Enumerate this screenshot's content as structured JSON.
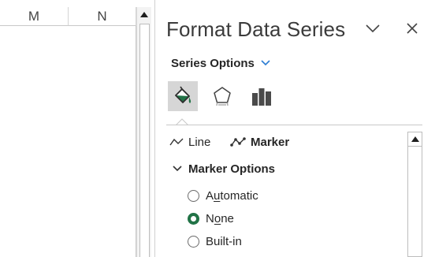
{
  "sheet": {
    "columns": [
      "M",
      "N"
    ]
  },
  "pane": {
    "title": "Format Data Series",
    "series_options_label": "Series Options",
    "tabs": [
      {
        "name": "fill-line",
        "icon": "paint-bucket-icon",
        "selected": true
      },
      {
        "name": "effects",
        "icon": "pentagon-icon",
        "selected": false
      },
      {
        "name": "series-options",
        "icon": "bar-chart-icon",
        "selected": false
      }
    ],
    "subtabs": {
      "line": "Line",
      "marker": "Marker"
    },
    "section": {
      "title": "Marker Options",
      "options": [
        {
          "pre": "A",
          "ul": "u",
          "post": "tomatic",
          "checked": false
        },
        {
          "pre": "N",
          "ul": "o",
          "post": "ne",
          "checked": true
        },
        {
          "pre": "Built-in",
          "ul": "",
          "post": "",
          "checked": false
        }
      ]
    }
  },
  "colors": {
    "accent": "#217346",
    "chevron_blue": "#2b7cd3"
  }
}
